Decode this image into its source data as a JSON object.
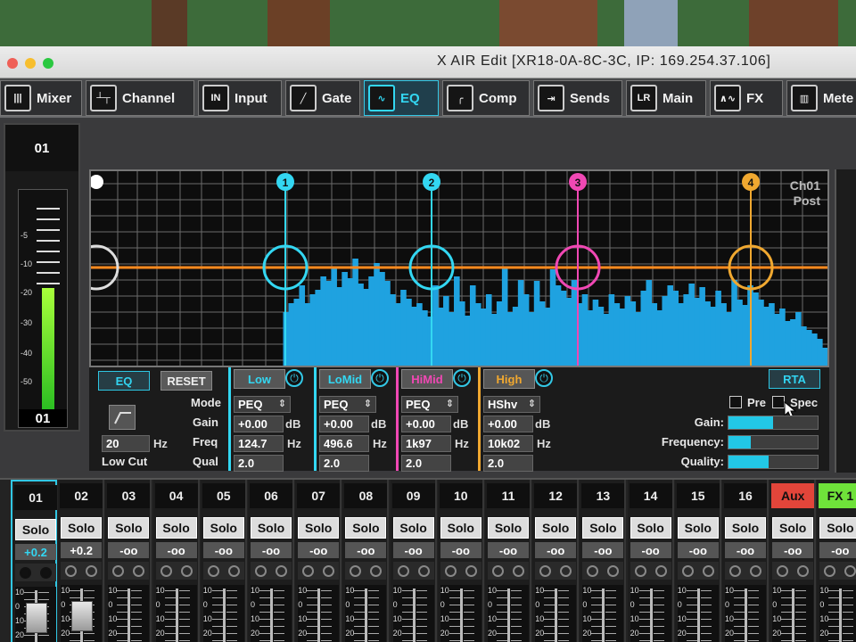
{
  "window": {
    "title": "X AIR Edit [XR18-0A-8C-3C, IP: 169.254.37.106]"
  },
  "tabs": [
    {
      "label": "Mixer",
      "icon": "mixer-icon"
    },
    {
      "label": "Channel",
      "icon": "channel-icon"
    },
    {
      "label": "Input",
      "icon": "input-icon",
      "icon_text": "IN"
    },
    {
      "label": "Gate",
      "icon": "gate-icon"
    },
    {
      "label": "EQ",
      "icon": "eq-icon",
      "active": true
    },
    {
      "label": "Comp",
      "icon": "comp-icon"
    },
    {
      "label": "Sends",
      "icon": "sends-icon"
    },
    {
      "label": "Main",
      "icon": "main-icon"
    },
    {
      "label": "FX",
      "icon": "fx-icon"
    },
    {
      "label": "Mete",
      "icon": "meter-icon"
    }
  ],
  "channel_strip": {
    "number": "01",
    "footer": "01",
    "meter_labels": [
      "-5",
      "-10",
      "-20",
      "-30",
      "-40",
      "-50"
    ],
    "meter_level": 0.55
  },
  "graph": {
    "channel": "Ch01",
    "tap": "Post",
    "band_markers": [
      "1",
      "2",
      "3",
      "4"
    ]
  },
  "controls": {
    "eq_button": "EQ",
    "reset_button": "RESET",
    "low_cut_freq": "20",
    "low_cut_unit": "Hz",
    "low_cut_label": "Low Cut",
    "row_labels": [
      "Mode",
      "Gain",
      "Freq",
      "Qual"
    ],
    "db": "dB",
    "hz": "Hz",
    "bands": [
      {
        "name": "Low",
        "mode": "PEQ",
        "gain": "+0.00",
        "freq": "124.7",
        "q": "2.0",
        "color": "#33d7f2"
      },
      {
        "name": "LoMid",
        "mode": "PEQ",
        "gain": "+0.00",
        "freq": "496.6",
        "q": "2.0",
        "color": "#33d7f2"
      },
      {
        "name": "HiMid",
        "mode": "PEQ",
        "gain": "+0.00",
        "freq": "1k97",
        "q": "2.0",
        "color": "#f048b4"
      },
      {
        "name": "High",
        "mode": "HShv",
        "gain": "+0.00",
        "freq": "10k02",
        "q": "2.0",
        "color": "#f0a830"
      }
    ],
    "rta": {
      "button": "RTA",
      "pre_label": "Pre",
      "spec_label": "Spec",
      "gain_label": "Gain:",
      "frequency_label": "Frequency:",
      "quality_label": "Quality:",
      "gain": 0.5,
      "frequency": 0.25,
      "quality": 0.45
    }
  },
  "mixer": {
    "channels": [
      {
        "n": "01",
        "solo": "Solo",
        "val": "+0.2",
        "fader": 0.6,
        "sel": true
      },
      {
        "n": "02",
        "solo": "Solo",
        "val": "+0.2",
        "fader": 0.6
      },
      {
        "n": "03",
        "solo": "Solo",
        "val": "-oo"
      },
      {
        "n": "04",
        "solo": "Solo",
        "val": "-oo"
      },
      {
        "n": "05",
        "solo": "Solo",
        "val": "-oo"
      },
      {
        "n": "06",
        "solo": "Solo",
        "val": "-oo"
      },
      {
        "n": "07",
        "solo": "Solo",
        "val": "-oo"
      },
      {
        "n": "08",
        "solo": "Solo",
        "val": "-oo"
      },
      {
        "n": "09",
        "solo": "Solo",
        "val": "-oo"
      },
      {
        "n": "10",
        "solo": "Solo",
        "val": "-oo"
      },
      {
        "n": "11",
        "solo": "Solo",
        "val": "-oo"
      },
      {
        "n": "12",
        "solo": "Solo",
        "val": "-oo"
      },
      {
        "n": "13",
        "solo": "Solo",
        "val": "-oo"
      },
      {
        "n": "14",
        "solo": "Solo",
        "val": "-oo"
      },
      {
        "n": "15",
        "solo": "Solo",
        "val": "-oo"
      },
      {
        "n": "16",
        "solo": "Solo",
        "val": "-oo"
      },
      {
        "n": "Aux",
        "solo": "Solo",
        "val": "-oo",
        "bg": "#e2453a"
      },
      {
        "n": "FX 1",
        "solo": "Solo",
        "val": "-oo",
        "bg": "#6fe23a"
      }
    ],
    "fader_labels": [
      "10",
      "0",
      "10",
      "20"
    ]
  }
}
